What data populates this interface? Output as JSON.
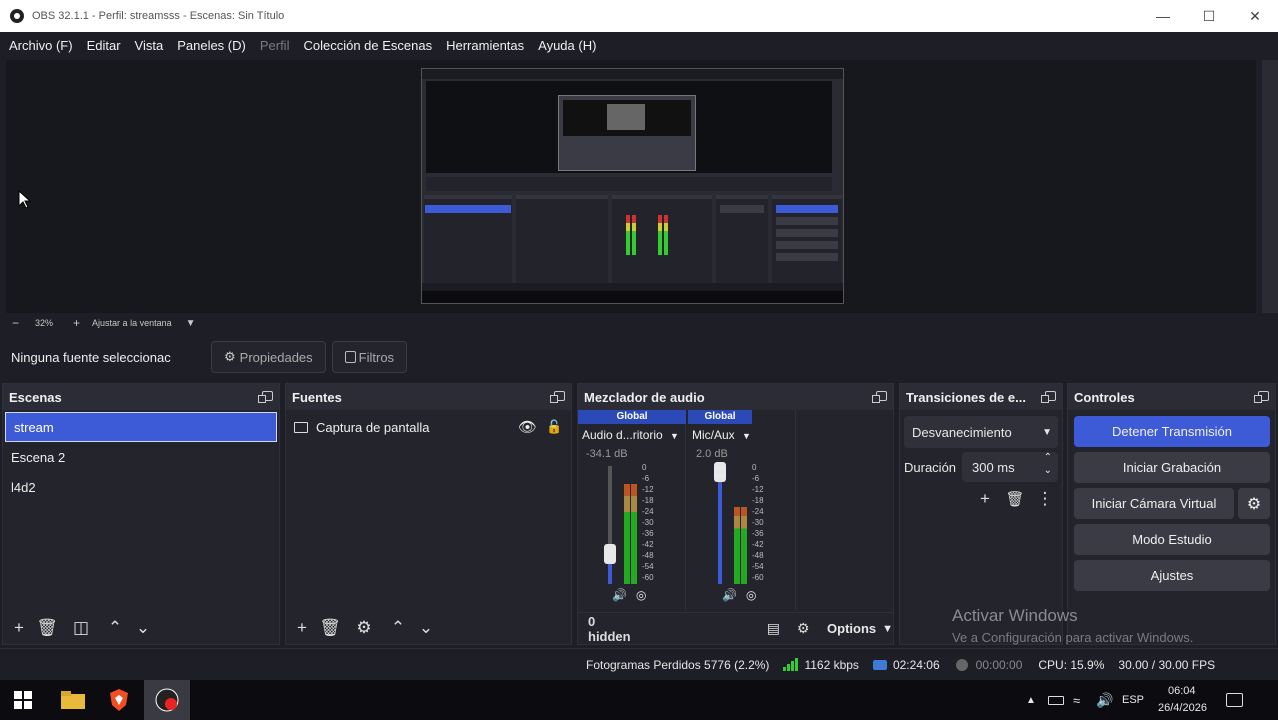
{
  "window": {
    "title": "OBS 32.1.1 - Perfil: streamsss - Escenas: Sin Título"
  },
  "menu": {
    "items": [
      {
        "label": "Archivo (F)",
        "enabled": true
      },
      {
        "label": "Editar",
        "enabled": true
      },
      {
        "label": "Vista",
        "enabled": true
      },
      {
        "label": "Paneles (D)",
        "enabled": true
      },
      {
        "label": "Perfil",
        "enabled": false
      },
      {
        "label": "Colección de Escenas",
        "enabled": true
      },
      {
        "label": "Herramientas",
        "enabled": true
      },
      {
        "label": "Ayuda (H)",
        "enabled": true
      }
    ]
  },
  "zoom": {
    "minus": "−",
    "value": "32%",
    "plus": "+",
    "fit_label": "Ajustar a la ventana"
  },
  "source_bar": {
    "no_selection": "Ninguna fuente seleccionac",
    "properties": "Propiedades",
    "filters": "Filtros"
  },
  "scenes": {
    "title": "Escenas",
    "items": [
      {
        "label": "stream",
        "selected": true
      },
      {
        "label": "Escena 2",
        "selected": false
      },
      {
        "label": "l4d2",
        "selected": false
      }
    ]
  },
  "sources": {
    "title": "Fuentes",
    "items": [
      {
        "label": "Captura de pantalla",
        "icon": "monitor-icon"
      }
    ]
  },
  "mixer": {
    "title": "Mezclador de audio",
    "channels": [
      {
        "badge": "Global",
        "name": "Audio d...ritorio",
        "db": "-34.1 dB",
        "fader_level": 0.25,
        "meter_level": 0.85
      },
      {
        "badge": "Global",
        "name": "Mic/Aux",
        "db": "2.0 dB",
        "fader_level": 0.95,
        "meter_level": 0.65
      }
    ],
    "scale": [
      "0",
      "-6",
      "-12",
      "-18",
      "-24",
      "-30",
      "-36",
      "-42",
      "-48",
      "-54",
      "-60"
    ],
    "hidden": "0 hidden",
    "options": "Options"
  },
  "transitions": {
    "title": "Transiciones de e...",
    "selected": "Desvanecimiento",
    "duration_label": "Duración",
    "duration_value": "300 ms"
  },
  "controls": {
    "title": "Controles",
    "buttons": {
      "stream": "Detener Transmisión",
      "record": "Iniciar Grabación",
      "virtualcam": "Iniciar Cámara Virtual",
      "studio": "Modo Estudio",
      "settings": "Ajustes"
    }
  },
  "status": {
    "dropped": "Fotogramas Perdidos 5776 (2.2%)",
    "bitrate": "1162 kbps",
    "stream_time": "02:24:06",
    "rec_time": "00:00:00",
    "cpu": "CPU: 15.9%",
    "fps": "30.00 / 30.00 FPS"
  },
  "watermark": {
    "line1": "Activar Windows",
    "line2": "Ve a Configuración para activar Windows."
  },
  "taskbar": {
    "lang": "ESP",
    "time": "06:04",
    "date": "26/4/2026"
  },
  "colors": {
    "accent": "#3d5bd6",
    "bg": "#1e1f26",
    "dock": "#24252c"
  }
}
